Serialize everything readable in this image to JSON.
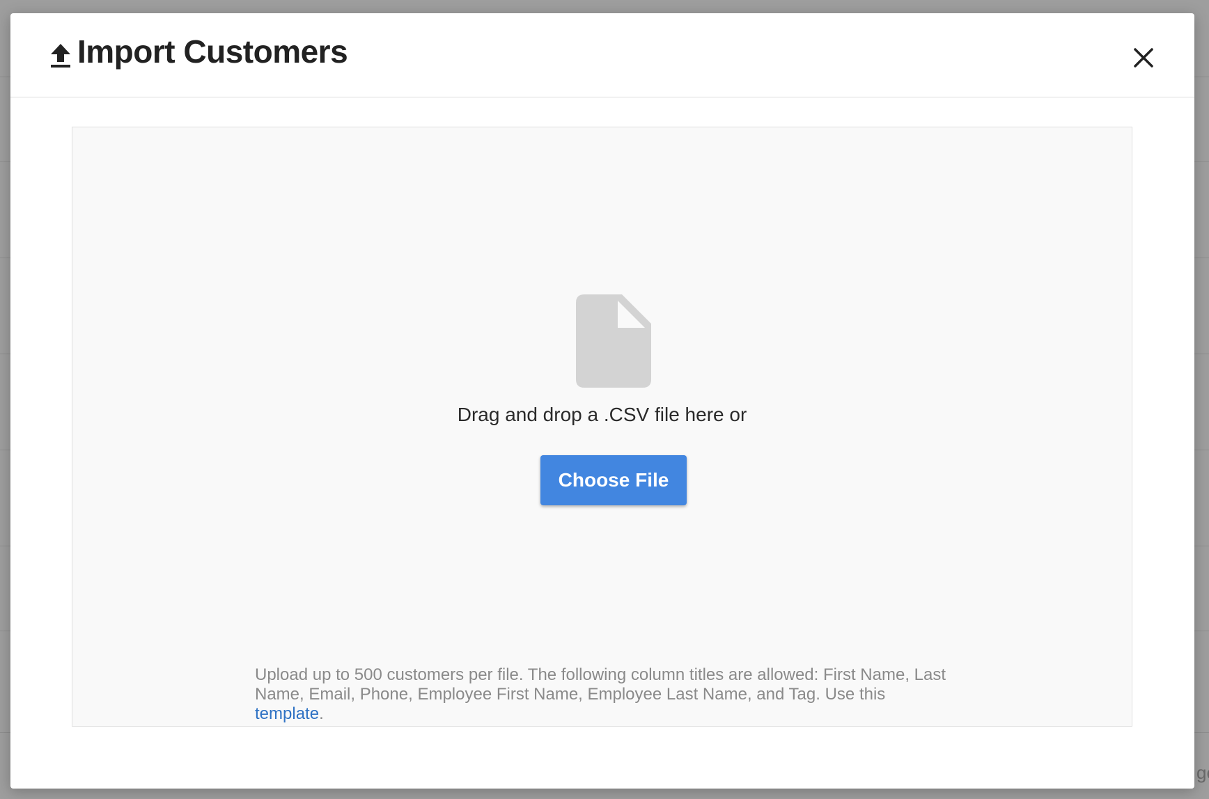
{
  "modal": {
    "title": "Import Customers",
    "title_icon": "upload-icon",
    "close_icon": "close-icon"
  },
  "dropzone": {
    "file_icon": "file-icon",
    "drop_text": "Drag and drop a .CSV file here or",
    "choose_button_label": "Choose File",
    "help_text": "Upload up to 500 customers per file. The following column titles are allowed: First Name, Last Name, Email, Phone, Employee First Name, Employee Last Name, and Tag. Use this",
    "help_link_label": "template",
    "help_suffix": "."
  },
  "background": {
    "peek_text": "ge"
  },
  "colors": {
    "primary_button": "#4286e0",
    "link": "#2f72c4",
    "overlay": "#9e9e9e",
    "dropzone_bg": "#f9f9f9",
    "icon_gray": "#d3d3d3"
  }
}
